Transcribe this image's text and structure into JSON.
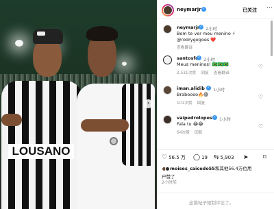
{
  "post": {
    "username": "neymarjr",
    "follow_status": "已关注",
    "more_label": "···"
  },
  "comments": [
    {
      "username": "neymarjr",
      "time": "2小时",
      "text": "Bom te ver meu menino ⚡",
      "mention": "@rodrygogoes ❤️",
      "meta": [
        "查看翻译"
      ]
    },
    {
      "username": "santosfc",
      "time": "2小时",
      "text": "Meus meninos! 🇧🇷🇧🇷🇧🇷",
      "meta": [
        "2,531次赞",
        "回复",
        "查看翻译"
      ]
    },
    {
      "username": "iman.alidib",
      "time": "1小时",
      "text": "Braboooo🔥😱",
      "meta": [
        "101次赞",
        "回复"
      ]
    },
    {
      "username": "vaipedrolopes",
      "time": "1小时",
      "text": "Fala tu 😂😂",
      "meta": [
        "64次赞",
        "回复"
      ]
    }
  ],
  "actions": {
    "likes": "56.5 万",
    "comments": "19",
    "shares": "5,903"
  },
  "likes_summary": {
    "user": "moises_caicedo55",
    "rest": "和其他56.4万位用",
    "rest2": "户赞了"
  },
  "post_time": "2小时前",
  "comment_box": {
    "placeholder": "这篇帖子限制评论了。"
  },
  "colors": {
    "verified": "#3897f0",
    "mention": "#3b6fb0"
  }
}
